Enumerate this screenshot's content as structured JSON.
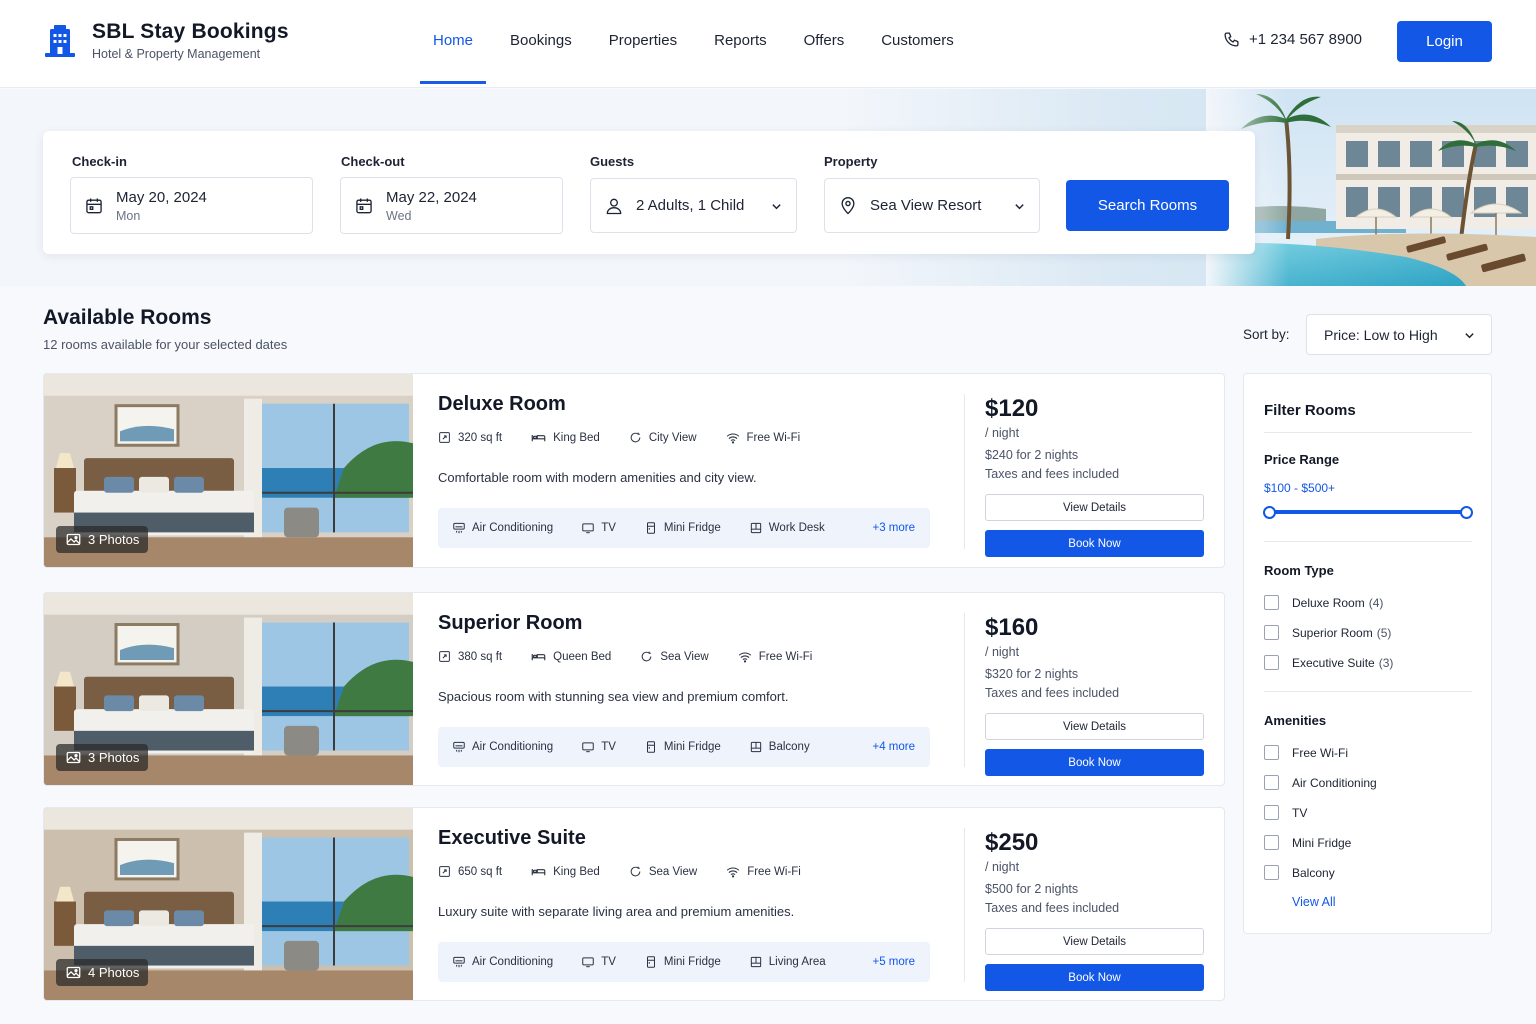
{
  "brand": {
    "title": "SBL Stay Bookings",
    "subtitle": "Hotel & Property Management",
    "icon": "building-icon",
    "accent": "#1257e6"
  },
  "nav": {
    "items": [
      {
        "label": "Home",
        "active": true
      },
      {
        "label": "Bookings"
      },
      {
        "label": "Properties"
      },
      {
        "label": "Reports"
      },
      {
        "label": "Offers"
      },
      {
        "label": "Customers"
      }
    ],
    "phone": "+1 234 567 8900",
    "login_label": "Login"
  },
  "search": {
    "checkin": {
      "label": "Check-in",
      "date": "May 20, 2024",
      "day": "Mon"
    },
    "checkout": {
      "label": "Check-out",
      "date": "May 22, 2024",
      "day": "Wed"
    },
    "guests": {
      "label": "Guests",
      "value": "2 Adults, 1 Child"
    },
    "property": {
      "label": "Property",
      "value": "Sea View Resort"
    },
    "button_label": "Search Rooms"
  },
  "results": {
    "title": "Available Rooms",
    "subtitle": "12 rooms available for your selected dates",
    "sort_label": "Sort by:",
    "sort_value": "Price: Low to High"
  },
  "rooms": [
    {
      "name": "Deluxe Room",
      "photos": "3 Photos",
      "size": "320 sq ft",
      "bed": "King Bed",
      "view": "City View",
      "wifi": "Free Wi-Fi",
      "description": "Comfortable room with modern amenities and city view.",
      "amenities": [
        "Air Conditioning",
        "TV",
        "Mini Fridge",
        "Work Desk"
      ],
      "more": "+3 more",
      "price": "$120",
      "per_night": "/ night",
      "total": "$240 for 2 nights",
      "taxes": "Taxes and fees included",
      "details_label": "View Details",
      "book_label": "Book Now"
    },
    {
      "name": "Superior Room",
      "photos": "3 Photos",
      "size": "380 sq ft",
      "bed": "Queen Bed",
      "view": "Sea View",
      "wifi": "Free Wi-Fi",
      "description": "Spacious room with stunning sea view and premium comfort.",
      "amenities": [
        "Air Conditioning",
        "TV",
        "Mini Fridge",
        "Balcony"
      ],
      "more": "+4 more",
      "price": "$160",
      "per_night": "/ night",
      "total": "$320 for 2 nights",
      "taxes": "Taxes and fees included",
      "details_label": "View Details",
      "book_label": "Book Now"
    },
    {
      "name": "Executive Suite",
      "photos": "4 Photos",
      "size": "650 sq ft",
      "bed": "King Bed",
      "view": "Sea View",
      "wifi": "Free Wi-Fi",
      "description": "Luxury suite with separate living area and premium amenities.",
      "amenities": [
        "Air Conditioning",
        "TV",
        "Mini Fridge",
        "Living Area"
      ],
      "more": "+5 more",
      "price": "$250",
      "per_night": "/ night",
      "total": "$500 for 2 nights",
      "taxes": "Taxes and fees included",
      "details_label": "View Details",
      "book_label": "Book Now"
    }
  ],
  "filter": {
    "title": "Filter Rooms",
    "price_heading": "Price Range",
    "price_range": "$100 - $500+",
    "room_type_heading": "Room Type",
    "room_types": [
      {
        "label": "Deluxe Room",
        "count": "(4)"
      },
      {
        "label": "Superior Room",
        "count": "(5)"
      },
      {
        "label": "Executive Suite",
        "count": "(3)"
      }
    ],
    "amenities_heading": "Amenities",
    "amenities": [
      "Free Wi-Fi",
      "Air Conditioning",
      "TV",
      "Mini Fridge",
      "Balcony"
    ],
    "view_all": "View All"
  }
}
